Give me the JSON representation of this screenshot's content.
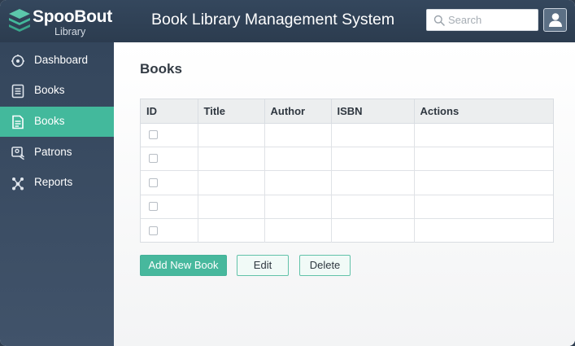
{
  "header": {
    "brand_name": "SpooBout",
    "brand_sub": "Library",
    "app_title": "Book Library Management System",
    "search_placeholder": "Search",
    "search_value": ""
  },
  "sidebar": {
    "items": [
      {
        "label": "Dashboard",
        "icon": "dashboard-icon",
        "active": false
      },
      {
        "label": "Books",
        "icon": "book-list-icon",
        "active": false
      },
      {
        "label": "Books",
        "icon": "book-open-icon",
        "active": true
      },
      {
        "label": "Patrons",
        "icon": "patrons-icon",
        "active": false
      },
      {
        "label": "Reports",
        "icon": "reports-icon",
        "active": false
      }
    ]
  },
  "main": {
    "page_title": "Books",
    "table": {
      "columns": [
        "ID",
        "Title",
        "Author",
        "ISBN",
        "Actions"
      ],
      "rows": [
        {
          "checked": false,
          "title": "",
          "author": "",
          "isbn": "",
          "actions": ""
        },
        {
          "checked": false,
          "title": "",
          "author": "",
          "isbn": "",
          "actions": ""
        },
        {
          "checked": false,
          "title": "",
          "author": "",
          "isbn": "",
          "actions": ""
        },
        {
          "checked": false,
          "title": "",
          "author": "",
          "isbn": "",
          "actions": ""
        },
        {
          "checked": false,
          "title": "",
          "author": "",
          "isbn": "",
          "actions": ""
        }
      ]
    },
    "buttons": {
      "add": "Add New Book",
      "edit": "Edit",
      "delete": "Delete"
    }
  },
  "colors": {
    "accent": "#43b99c",
    "header_bg": "#2f3f52",
    "sidebar_bg": "#3a4c62"
  }
}
